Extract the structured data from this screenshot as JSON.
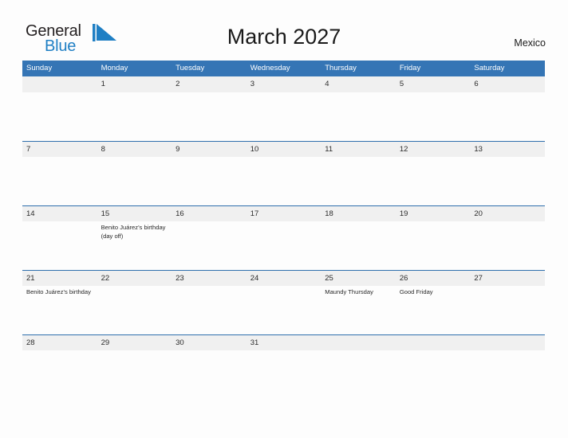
{
  "header": {
    "logo": {
      "text_primary": "General",
      "text_secondary": "Blue",
      "flag_icon": "blue-flag-triangle-icon",
      "color_primary": "#231f20",
      "color_secondary": "#1f7fc4"
    },
    "title": "March 2027",
    "region": "Mexico"
  },
  "theme": {
    "header_blue": "#3575b5",
    "rule_blue": "#2f6fad",
    "band_gray": "#f0f0f0",
    "page_background": "#fdfdfd",
    "text_dark": "#2b2b2b"
  },
  "calendar": {
    "month": "March",
    "year": "2027",
    "weekdays": [
      "Sunday",
      "Monday",
      "Tuesday",
      "Wednesday",
      "Thursday",
      "Friday",
      "Saturday"
    ],
    "weeks": [
      [
        {
          "date": "",
          "event": ""
        },
        {
          "date": "1",
          "event": ""
        },
        {
          "date": "2",
          "event": ""
        },
        {
          "date": "3",
          "event": ""
        },
        {
          "date": "4",
          "event": ""
        },
        {
          "date": "5",
          "event": ""
        },
        {
          "date": "6",
          "event": ""
        }
      ],
      [
        {
          "date": "7",
          "event": ""
        },
        {
          "date": "8",
          "event": ""
        },
        {
          "date": "9",
          "event": ""
        },
        {
          "date": "10",
          "event": ""
        },
        {
          "date": "11",
          "event": ""
        },
        {
          "date": "12",
          "event": ""
        },
        {
          "date": "13",
          "event": ""
        }
      ],
      [
        {
          "date": "14",
          "event": ""
        },
        {
          "date": "15",
          "event": "Benito Juárez’s birthday (day off)"
        },
        {
          "date": "16",
          "event": ""
        },
        {
          "date": "17",
          "event": ""
        },
        {
          "date": "18",
          "event": ""
        },
        {
          "date": "19",
          "event": ""
        },
        {
          "date": "20",
          "event": ""
        }
      ],
      [
        {
          "date": "21",
          "event": "Benito Juárez’s birthday"
        },
        {
          "date": "22",
          "event": ""
        },
        {
          "date": "23",
          "event": ""
        },
        {
          "date": "24",
          "event": ""
        },
        {
          "date": "25",
          "event": "Maundy Thursday"
        },
        {
          "date": "26",
          "event": "Good Friday"
        },
        {
          "date": "27",
          "event": ""
        }
      ],
      [
        {
          "date": "28",
          "event": ""
        },
        {
          "date": "29",
          "event": ""
        },
        {
          "date": "30",
          "event": ""
        },
        {
          "date": "31",
          "event": ""
        },
        {
          "date": "",
          "event": ""
        },
        {
          "date": "",
          "event": ""
        },
        {
          "date": "",
          "event": ""
        }
      ]
    ]
  }
}
